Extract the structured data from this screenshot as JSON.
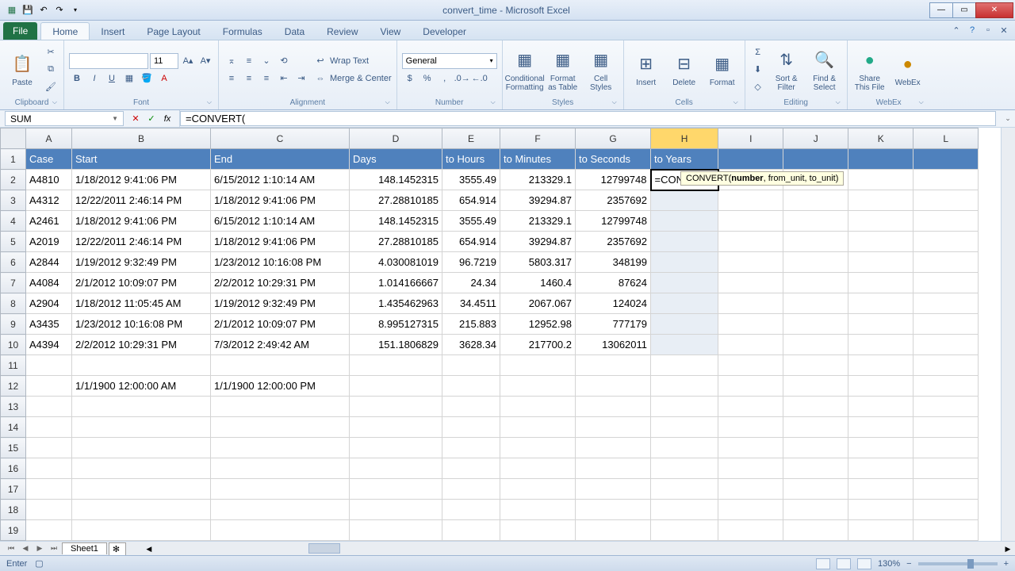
{
  "window": {
    "title": "convert_time - Microsoft Excel"
  },
  "qat": {
    "save": "💾",
    "undo": "↶",
    "redo": "↷"
  },
  "tabs": {
    "file": "File",
    "home": "Home",
    "insert": "Insert",
    "page_layout": "Page Layout",
    "formulas": "Formulas",
    "data": "Data",
    "review": "Review",
    "view": "View",
    "developer": "Developer"
  },
  "ribbon": {
    "clipboard": {
      "label": "Clipboard",
      "paste": "Paste"
    },
    "font": {
      "label": "Font",
      "size": "11"
    },
    "alignment": {
      "label": "Alignment",
      "wrap": "Wrap Text",
      "merge": "Merge & Center"
    },
    "number": {
      "label": "Number",
      "format": "General"
    },
    "styles": {
      "label": "Styles",
      "cond": "Conditional Formatting",
      "table": "Format as Table",
      "cell": "Cell Styles"
    },
    "cells": {
      "label": "Cells",
      "insert": "Insert",
      "delete": "Delete",
      "format": "Format"
    },
    "editing": {
      "label": "Editing",
      "sort": "Sort & Filter",
      "find": "Find & Select"
    },
    "share": {
      "label": "WebEx",
      "share_file": "Share This File",
      "webex": "WebEx"
    }
  },
  "namebox": "SUM",
  "formula_bar": "=CONVERT(",
  "tooltip": {
    "fn": "CONVERT(",
    "arg1": "number",
    "rest": ", from_unit, to_unit)"
  },
  "columns": [
    "A",
    "B",
    "C",
    "D",
    "E",
    "F",
    "G",
    "H",
    "I",
    "J",
    "K",
    "L"
  ],
  "headers": {
    "A": "Case",
    "B": "Start",
    "C": "End",
    "D": "Days",
    "E": "to Hours",
    "F": "to Minutes",
    "G": "to Seconds",
    "H": "to Years"
  },
  "rows": [
    {
      "n": 2,
      "A": "A4810",
      "B": "1/18/2012 9:41:06 PM",
      "C": "6/15/2012 1:10:14 AM",
      "D": "148.1452315",
      "E": "3555.49",
      "F": "213329.1",
      "G": "12799748",
      "H": "=CONVERT("
    },
    {
      "n": 3,
      "A": "A4312",
      "B": "12/22/2011 2:46:14 PM",
      "C": "1/18/2012 9:41:06 PM",
      "D": "27.28810185",
      "E": "654.914",
      "F": "39294.87",
      "G": "2357692",
      "H": ""
    },
    {
      "n": 4,
      "A": "A2461",
      "B": "1/18/2012 9:41:06 PM",
      "C": "6/15/2012 1:10:14 AM",
      "D": "148.1452315",
      "E": "3555.49",
      "F": "213329.1",
      "G": "12799748",
      "H": ""
    },
    {
      "n": 5,
      "A": "A2019",
      "B": "12/22/2011 2:46:14 PM",
      "C": "1/18/2012 9:41:06 PM",
      "D": "27.28810185",
      "E": "654.914",
      "F": "39294.87",
      "G": "2357692",
      "H": ""
    },
    {
      "n": 6,
      "A": "A2844",
      "B": "1/19/2012 9:32:49 PM",
      "C": "1/23/2012 10:16:08 PM",
      "D": "4.030081019",
      "E": "96.7219",
      "F": "5803.317",
      "G": "348199",
      "H": ""
    },
    {
      "n": 7,
      "A": "A4084",
      "B": "2/1/2012 10:09:07 PM",
      "C": "2/2/2012 10:29:31 PM",
      "D": "1.014166667",
      "E": "24.34",
      "F": "1460.4",
      "G": "87624",
      "H": ""
    },
    {
      "n": 8,
      "A": "A2904",
      "B": "1/18/2012 11:05:45 AM",
      "C": "1/19/2012 9:32:49 PM",
      "D": "1.435462963",
      "E": "34.4511",
      "F": "2067.067",
      "G": "124024",
      "H": ""
    },
    {
      "n": 9,
      "A": "A3435",
      "B": "1/23/2012 10:16:08 PM",
      "C": "2/1/2012 10:09:07 PM",
      "D": "8.995127315",
      "E": "215.883",
      "F": "12952.98",
      "G": "777179",
      "H": ""
    },
    {
      "n": 10,
      "A": "A4394",
      "B": "2/2/2012 10:29:31 PM",
      "C": "7/3/2012 2:49:42 AM",
      "D": "151.1806829",
      "E": "3628.34",
      "F": "217700.2",
      "G": "13062011",
      "H": ""
    }
  ],
  "extra_row": {
    "n": 12,
    "B": "1/1/1900 12:00:00 AM",
    "C": "1/1/1900 12:00:00 PM"
  },
  "sheet_tab": "Sheet1",
  "status": {
    "mode": "Enter",
    "zoom": "130%"
  }
}
